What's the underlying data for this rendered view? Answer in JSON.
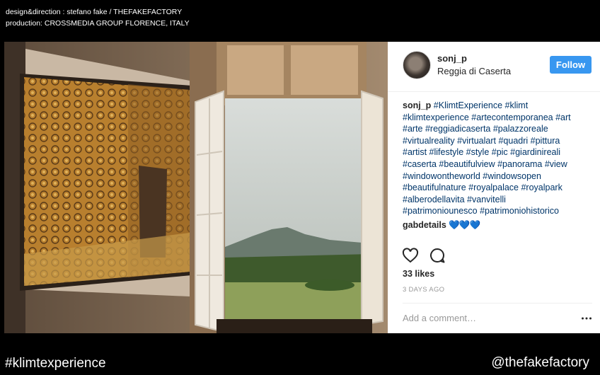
{
  "credits": {
    "line1": "design&direction : stefano fake / THEFAKEFACTORY",
    "line2": "production: CROSSMEDIA GROUP FLORENCE, ITALY"
  },
  "post": {
    "username": "sonj_p",
    "location": "Reggia di Caserta",
    "follow_label": "Follow",
    "caption_user": "sonj_p",
    "caption_lines": [
      "#KlimtExperience #klimt",
      "#klimtexperience #artecontemporanea #art",
      "#arte #reggiadicaserta #palazzoreale",
      "#virtualreality #virtualart #quadri #pittura",
      "#artist #lifestyle #style #pic #giardinireali",
      "#caserta #beautifulview #panorama #view",
      "#windowontheworld #windowsopen",
      "#beautifulnature #royalpalace #royalpark",
      "#alberodellavita #vanvitelli",
      "#patrimoniounesco #patrimoniohistorico"
    ],
    "comment_user": "gabdetails",
    "comment_text": "💙💙💙",
    "likes": "33 likes",
    "time": "3 DAYS AGO",
    "comment_placeholder": "Add a comment…",
    "icons": [
      "heart-icon",
      "comment-icon",
      "more-options-icon"
    ],
    "accent_color": "#3897f0",
    "hashtag_color": "#003569"
  },
  "footer": {
    "hashtag": "#klimtexperience",
    "handle": "@thefakefactory"
  }
}
